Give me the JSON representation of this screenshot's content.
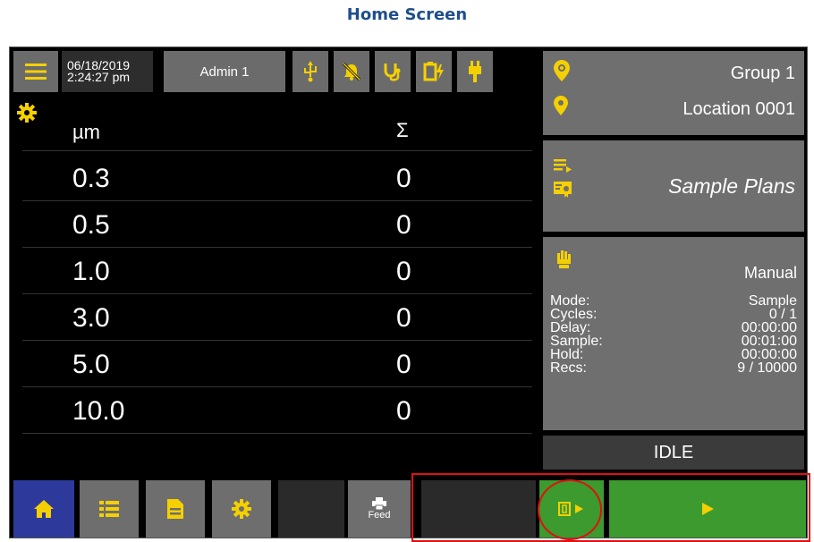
{
  "page": {
    "title": "Home Screen"
  },
  "topbar": {
    "date": "06/18/2019",
    "time": "2:24:27 pm",
    "user": "Admin 1",
    "icons": [
      "menu-icon",
      "usb-icon",
      "alarm-off-icon",
      "stethoscope-icon",
      "battery-charging-icon",
      "plug-icon"
    ]
  },
  "table": {
    "header": {
      "size": "µm",
      "count": "Σ"
    },
    "rows": [
      {
        "size": "0.3",
        "count": "0"
      },
      {
        "size": "0.5",
        "count": "0"
      },
      {
        "size": "1.0",
        "count": "0"
      },
      {
        "size": "3.0",
        "count": "0"
      },
      {
        "size": "5.0",
        "count": "0"
      },
      {
        "size": "10.0",
        "count": "0"
      }
    ]
  },
  "location": {
    "group": "Group 1",
    "location": "Location 0001"
  },
  "plans": {
    "label": "Sample Plans"
  },
  "mode": {
    "title": "Manual",
    "fields": [
      {
        "key": "Mode:",
        "value": "Sample"
      },
      {
        "key": "Cycles:",
        "value": "0 / 1"
      },
      {
        "key": "Delay:",
        "value": "00:00:00"
      },
      {
        "key": "Sample:",
        "value": "00:01:00"
      },
      {
        "key": "Hold:",
        "value": "00:00:00"
      },
      {
        "key": "Recs:",
        "value": "9 / 10000"
      }
    ]
  },
  "status": {
    "text": "IDLE"
  },
  "bottom": {
    "feed_label": "Feed"
  },
  "colors": {
    "accent_yellow": "#f5d000",
    "home_blue": "#2d3a9c",
    "start_green": "#3c9a2e",
    "annotation_red": "#e01010"
  }
}
